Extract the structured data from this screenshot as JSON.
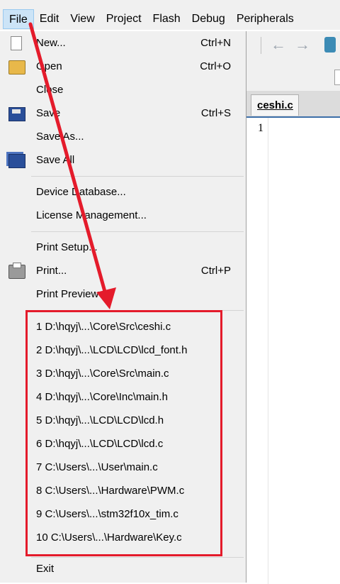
{
  "menubar": {
    "items": [
      {
        "label": "File",
        "active": true
      },
      {
        "label": "Edit"
      },
      {
        "label": "View"
      },
      {
        "label": "Project"
      },
      {
        "label": "Flash"
      },
      {
        "label": "Debug"
      },
      {
        "label": "Peripherals"
      }
    ]
  },
  "editor": {
    "tab_label": "ceshi.c",
    "line_number": "1"
  },
  "file_menu": {
    "items": [
      {
        "name": "new",
        "label": "New...",
        "shortcut": "Ctrl+N",
        "icon": "new-file-icon"
      },
      {
        "name": "open",
        "label": "Open",
        "shortcut": "Ctrl+O",
        "icon": "open-folder-icon"
      },
      {
        "name": "close",
        "label": "Close",
        "shortcut": "",
        "icon": ""
      },
      {
        "name": "save",
        "label": "Save",
        "shortcut": "Ctrl+S",
        "icon": "save-disk-icon"
      },
      {
        "name": "save-as",
        "label": "Save As...",
        "shortcut": "",
        "icon": ""
      },
      {
        "name": "save-all",
        "label": "Save All",
        "shortcut": "",
        "icon": "save-all-icon"
      },
      {
        "name": "device-database",
        "label": "Device Database...",
        "shortcut": "",
        "icon": ""
      },
      {
        "name": "license-management",
        "label": "License Management...",
        "shortcut": "",
        "icon": ""
      },
      {
        "name": "print-setup",
        "label": "Print Setup...",
        "shortcut": "",
        "icon": ""
      },
      {
        "name": "print",
        "label": "Print...",
        "shortcut": "Ctrl+P",
        "icon": "printer-icon"
      },
      {
        "name": "print-preview",
        "label": "Print Preview",
        "shortcut": "",
        "icon": ""
      }
    ],
    "recent_files": [
      "1 D:\\hqyj\\...\\Core\\Src\\ceshi.c",
      "2 D:\\hqyj\\...\\LCD\\LCD\\lcd_font.h",
      "3 D:\\hqyj\\...\\Core\\Src\\main.c",
      "4 D:\\hqyj\\...\\Core\\Inc\\main.h",
      "5 D:\\hqyj\\...\\LCD\\LCD\\lcd.h",
      "6 D:\\hqyj\\...\\LCD\\LCD\\lcd.c",
      "7 C:\\Users\\...\\User\\main.c",
      "8 C:\\Users\\...\\Hardware\\PWM.c",
      "9 C:\\Users\\...\\stm32f10x_tim.c",
      "10 C:\\Users\\...\\Hardware\\Key.c"
    ],
    "exit_label": "Exit"
  },
  "annotation": {
    "color": "#e41b2b"
  },
  "colors": {
    "menu_bg": "#f0f0f0",
    "active_menu_bg": "#cce4f7"
  }
}
